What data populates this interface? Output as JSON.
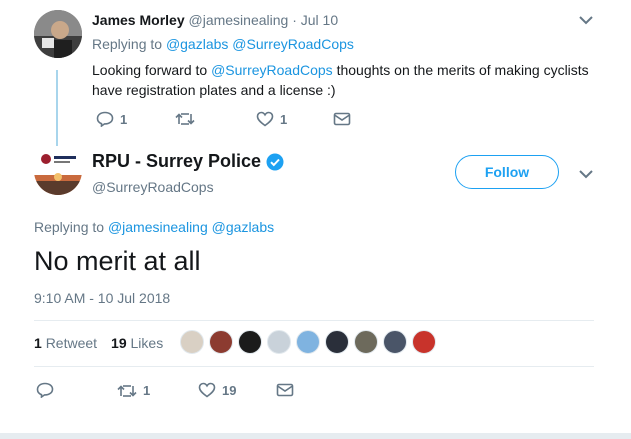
{
  "reply_tweet": {
    "author_name": "James Morley",
    "handle_date": "@jamesinealing · Jul 10",
    "replying_prefix": "Replying to",
    "replying_to_1": "@gazlabs",
    "replying_to_2": "@SurreyRoadCops",
    "text_before": "Looking forward to ",
    "text_mention": "@SurreyRoadCops",
    "text_after": " thoughts on the merits of making cyclists have registration plates and a license :)",
    "reply_count": "1",
    "retweet_count": "",
    "like_count": "1"
  },
  "main_tweet": {
    "author_name": "RPU - Surrey Police",
    "handle": "@SurreyRoadCops",
    "follow_label": "Follow",
    "replying_prefix": "Replying to",
    "replying_to_1": "@jamesinealing",
    "replying_to_2": "@gazlabs",
    "text": "No merit at all",
    "timestamp": "9:10 AM - 10 Jul 2018",
    "retweets_count": "1",
    "retweets_label": "Retweet",
    "likes_count": "19",
    "likes_label": "Likes",
    "reply_count": "",
    "retweet_action_count": "1",
    "like_action_count": "19"
  },
  "colors": {
    "accent": "#1da1f2",
    "link": "#1b95e0",
    "verified": "#1da1f2",
    "muted": "#657786"
  },
  "icons": [
    "chevron-down-icon",
    "reply-icon",
    "retweet-icon",
    "like-icon",
    "message-icon",
    "verified-badge-icon"
  ]
}
